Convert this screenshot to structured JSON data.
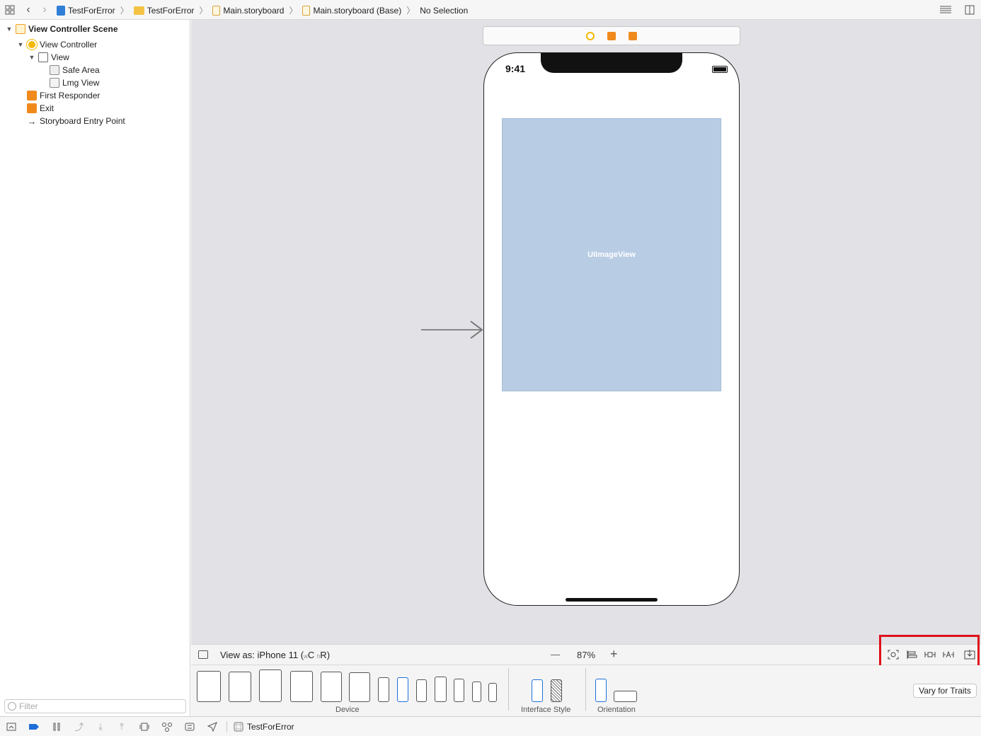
{
  "breadcrumb": {
    "items": [
      "TestForError",
      "TestForError",
      "Main.storyboard",
      "Main.storyboard (Base)",
      "No Selection"
    ]
  },
  "outline": {
    "rows": [
      {
        "label": "View Controller Scene",
        "icon": "scene-icon"
      },
      {
        "label": "View Controller",
        "icon": "view-controller-icon"
      },
      {
        "label": "View",
        "icon": "view-icon"
      },
      {
        "label": "Safe Area",
        "icon": "safe-area-icon"
      },
      {
        "label": "Lmg View",
        "icon": "image-view-icon"
      },
      {
        "label": "First Responder",
        "icon": "first-responder-icon"
      },
      {
        "label": "Exit",
        "icon": "exit-icon"
      },
      {
        "label": "Storyboard Entry Point",
        "icon": "arrow-right-icon"
      }
    ],
    "filter_placeholder": "Filter"
  },
  "canvas": {
    "status_time": "9:41",
    "image_view_label": "UIImageView"
  },
  "bottombar": {
    "view_as": "View as: iPhone 11 (",
    "size_w": "w",
    "size_c": "C",
    "size_h": "h",
    "size_r": "R",
    "size_close": ")",
    "zoom_minus": "—",
    "zoom": "87%",
    "zoom_plus": "+"
  },
  "devicebar": {
    "device_label": "Device",
    "interface_style_label": "Interface Style",
    "orientation_label": "Orientation",
    "vary_for_traits": "Vary for Traits"
  },
  "statusbar": {
    "target": "TestForError"
  },
  "colors": {
    "accent": "#1e6fd9",
    "image_view_fill": "#b8cce4",
    "highlight_box": "#e0101a",
    "canvas_bg": "#e1e1e6"
  }
}
